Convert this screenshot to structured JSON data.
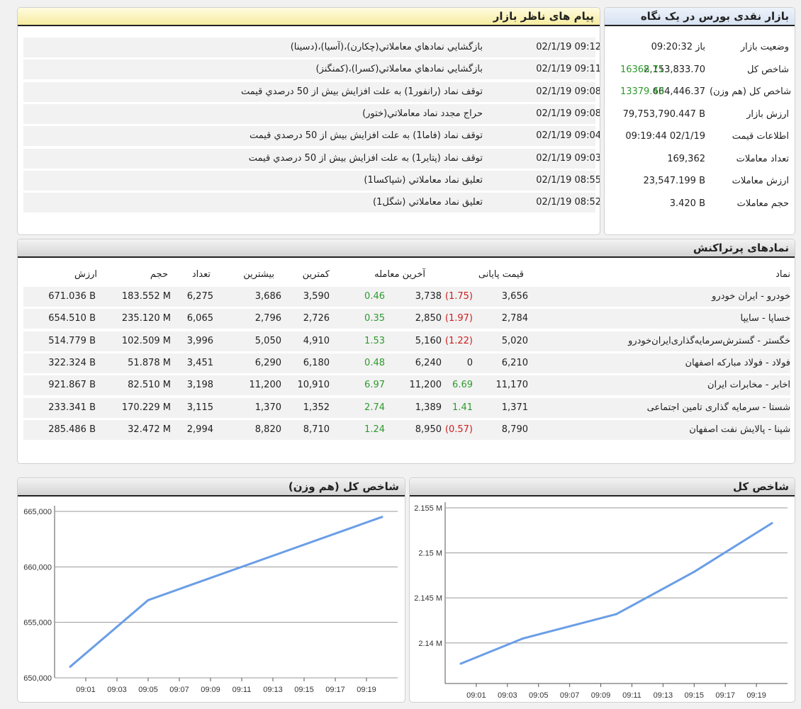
{
  "colors": {
    "green": "#2e9a2e",
    "red": "#d01c1c",
    "line": "#6a9ee6",
    "accent_blue": "#d6e1f1",
    "accent_yellow": "#f6ec9f"
  },
  "overview": {
    "title": "بازار نقدی بورس در یک نگاه",
    "rows": [
      {
        "label": "وضعیت بازار",
        "value": "باز 09:20:32",
        "change": ""
      },
      {
        "label": "شاخص کل",
        "value": "2,153,833.70",
        "change": "16368.71"
      },
      {
        "label": "شاخص کل (هم وزن)",
        "value": "664,446.37",
        "change": "13379.43"
      },
      {
        "label": "ارزش بازار",
        "value": "79,753,790.447 B",
        "change": ""
      },
      {
        "label": "اطلاعات قیمت",
        "value": "09:19:44 02/1/19",
        "change": ""
      },
      {
        "label": "تعداد معاملات",
        "value": "169,362",
        "change": ""
      },
      {
        "label": "ارزش معاملات",
        "value": "23,547.199 B",
        "change": ""
      },
      {
        "label": "حجم معاملات",
        "value": "3.420 B",
        "change": ""
      }
    ]
  },
  "messages": {
    "title": "پیام های ناظر بازار",
    "rows": [
      {
        "time": "02/1/19 09:12",
        "text": "بازگشايي نمادهاي معاملاتي(چكارن)،(آسيا)،(دسينا)"
      },
      {
        "time": "02/1/19 09:11",
        "text": "بازگشايي نمادهاي معاملاتي(كسرا)،(كمنگنز)"
      },
      {
        "time": "02/1/19 09:08",
        "text": "توقف نماد (رانفور1) به علت افزايش بيش از 50 درصدي قيمت"
      },
      {
        "time": "02/1/19 09:08",
        "text": "حراج مجدد نماد معاملاتي(ختور)"
      },
      {
        "time": "02/1/19 09:04",
        "text": "توقف نماد (فاما1) به علت افزايش بيش از 50 درصدي قيمت"
      },
      {
        "time": "02/1/19 09:03",
        "text": "توقف نماد (پتاير1) به علت افزايش بيش از 50 درصدي قيمت"
      },
      {
        "time": "02/1/19 08:55",
        "text": "تعليق نماد معاملاتي (شپاكسا1)"
      },
      {
        "time": "02/1/19 08:52",
        "text": "تعليق نماد معاملاتي (شگل1)"
      }
    ]
  },
  "symbols": {
    "title": "نمادهای پرتراکنش",
    "headers": {
      "symbol": "نماد",
      "close": "قیمت پایانی",
      "last": "آخرین معامله",
      "min": "کمترین",
      "max": "بیشترین",
      "count": "تعداد",
      "volume": "حجم",
      "value": "ارزش"
    },
    "rows": [
      {
        "symbol": "خودرو - ایران خودرو",
        "close": "3,656",
        "close_change": "(1.75)",
        "close_dir": "neg",
        "last": "3,738",
        "last_change": "0.46",
        "last_dir": "pos",
        "min": "3,590",
        "max": "3,686",
        "count": "6,275",
        "volume": "183.552 M",
        "value": "671.036 B"
      },
      {
        "symbol": "خساپا - سایپا",
        "close": "2,784",
        "close_change": "(1.97)",
        "close_dir": "neg",
        "last": "2,850",
        "last_change": "0.35",
        "last_dir": "pos",
        "min": "2,726",
        "max": "2,796",
        "count": "6,065",
        "volume": "235.120 M",
        "value": "654.510 B"
      },
      {
        "symbol": "خگستر - گسترش‌سرمایه‌گذاری‌ایران‌خودرو",
        "close": "5,020",
        "close_change": "(1.22)",
        "close_dir": "neg",
        "last": "5,160",
        "last_change": "1.53",
        "last_dir": "pos",
        "min": "4,910",
        "max": "5,050",
        "count": "3,996",
        "volume": "102.509 M",
        "value": "514.779 B"
      },
      {
        "symbol": "فولاد - فولاد مبارکه اصفهان",
        "close": "6,210",
        "close_change": "0",
        "close_dir": "zero",
        "last": "6,240",
        "last_change": "0.48",
        "last_dir": "pos",
        "min": "6,180",
        "max": "6,290",
        "count": "3,451",
        "volume": "51.878 M",
        "value": "322.324 B"
      },
      {
        "symbol": "اخابر - مخابرات ایران",
        "close": "11,170",
        "close_change": "6.69",
        "close_dir": "pos",
        "last": "11,200",
        "last_change": "6.97",
        "last_dir": "pos",
        "min": "10,910",
        "max": "11,200",
        "count": "3,198",
        "volume": "82.510 M",
        "value": "921.867 B"
      },
      {
        "symbol": "شستا - سرمایه گذاری تامین اجتماعی",
        "close": "1,371",
        "close_change": "1.41",
        "close_dir": "pos",
        "last": "1,389",
        "last_change": "2.74",
        "last_dir": "pos",
        "min": "1,352",
        "max": "1,370",
        "count": "3,115",
        "volume": "170.229 M",
        "value": "233.341 B"
      },
      {
        "symbol": "شپنا - پالایش نفت اصفهان",
        "close": "8,790",
        "close_change": "(0.57)",
        "close_dir": "neg",
        "last": "8,950",
        "last_change": "1.24",
        "last_dir": "pos",
        "min": "8,710",
        "max": "8,820",
        "count": "2,994",
        "volume": "32.472 M",
        "value": "285.486 B"
      }
    ]
  },
  "chart_data": [
    {
      "type": "line",
      "title": "شاخص کل",
      "x": [
        "09:00",
        "09:04",
        "09:10",
        "09:15",
        "09:20"
      ],
      "series": [
        {
          "values": [
            2137700,
            2140500,
            2143200,
            2147900,
            2153300
          ]
        }
      ],
      "xticks": [
        "09:01",
        "09:03",
        "09:05",
        "09:07",
        "09:09",
        "09:11",
        "09:13",
        "09:15",
        "09:17",
        "09:19"
      ],
      "ytick_values": [
        2140000,
        2145000,
        2150000,
        2155000
      ],
      "ytick_labels": [
        "2.14 M",
        "2.145 M",
        "2.15 M",
        "2.155 M"
      ],
      "ylim": [
        2135500,
        2155000
      ],
      "xlim": [
        "08:59",
        "09:21"
      ],
      "grid": true,
      "legend": "none"
    },
    {
      "type": "line",
      "title": "شاخص کل (هم وزن)",
      "x": [
        "09:00",
        "09:05",
        "09:11",
        "09:20"
      ],
      "series": [
        {
          "values": [
            651000,
            657000,
            660000,
            664500
          ]
        }
      ],
      "xticks": [
        "09:01",
        "09:03",
        "09:05",
        "09:07",
        "09:09",
        "09:11",
        "09:13",
        "09:15",
        "09:17",
        "09:19"
      ],
      "ytick_values": [
        650000,
        655000,
        660000,
        665000
      ],
      "ytick_labels": [
        "650,000",
        "655,000",
        "660,000",
        "665,000"
      ],
      "ylim": [
        650000,
        665000
      ],
      "xlim": [
        "08:59",
        "09:21"
      ],
      "grid": true,
      "legend": "none"
    }
  ]
}
